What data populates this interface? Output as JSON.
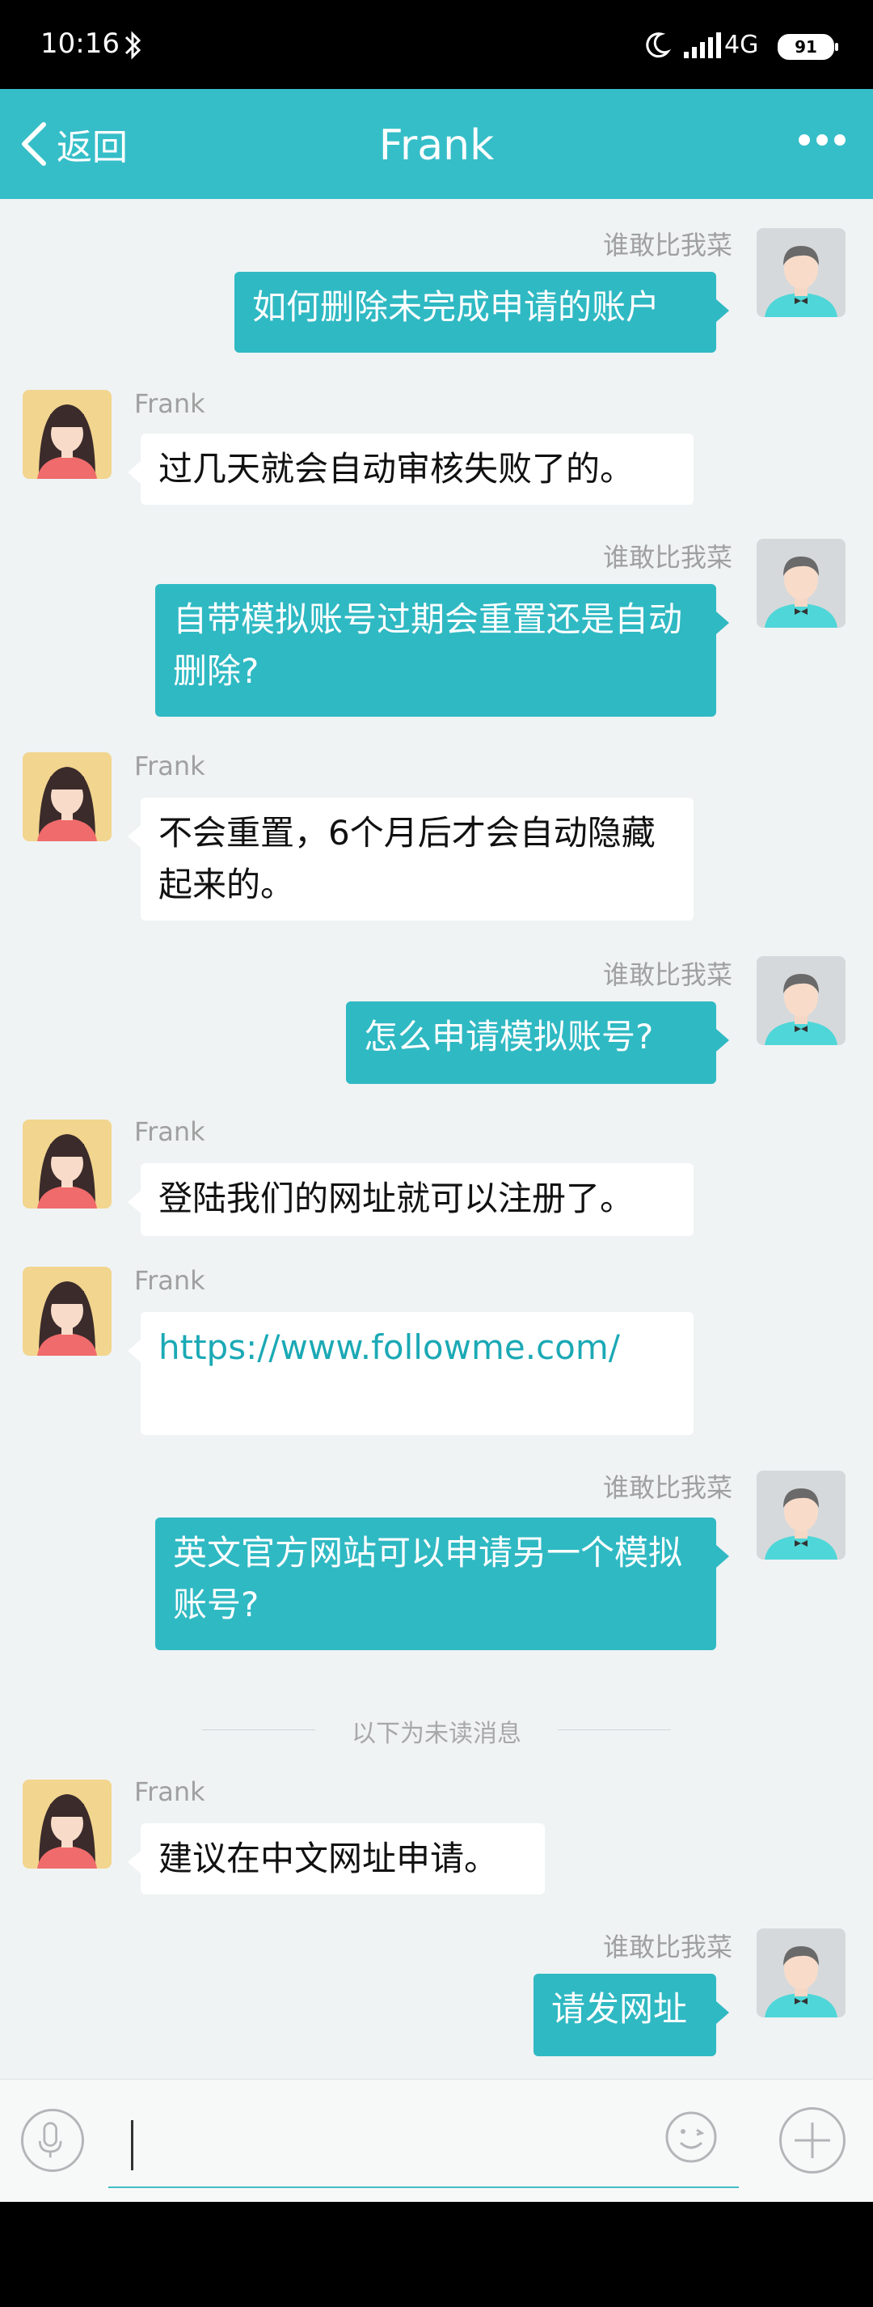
{
  "status_bar": {
    "time": "10:16",
    "network": "4G",
    "battery": "91"
  },
  "header": {
    "back_label": "返回",
    "title": "Frank"
  },
  "messages": [
    {
      "name": "谁敢比我菜",
      "text": "如何删除未完成申请的账户"
    },
    {
      "name": "Frank",
      "text": "过几天就会自动审核失败了的。"
    },
    {
      "name": "谁敢比我菜",
      "text": "自带模拟账号过期会重置还是自动删除?"
    },
    {
      "name": "Frank",
      "text": "不会重置，6个月后才会自动隐藏起来的。"
    },
    {
      "name": "谁敢比我菜",
      "text": "怎么申请模拟账号?"
    },
    {
      "name": "Frank",
      "text": "登陆我们的网址就可以注册了。"
    },
    {
      "name": "Frank",
      "text": "https://www.followme.com/"
    },
    {
      "name": "谁敢比我菜",
      "text": "英文官方网站可以申请另一个模拟账号?"
    },
    {
      "name": "Frank",
      "text": "建议在中文网址申请。"
    },
    {
      "name": "谁敢比我菜",
      "text": "请发网址"
    }
  ],
  "divider": {
    "text": "以下为未读消息"
  },
  "colors": {
    "accent": "#35bec8",
    "outgoing_bubble": "#2fb9c3",
    "link": "#1ba9b5"
  }
}
